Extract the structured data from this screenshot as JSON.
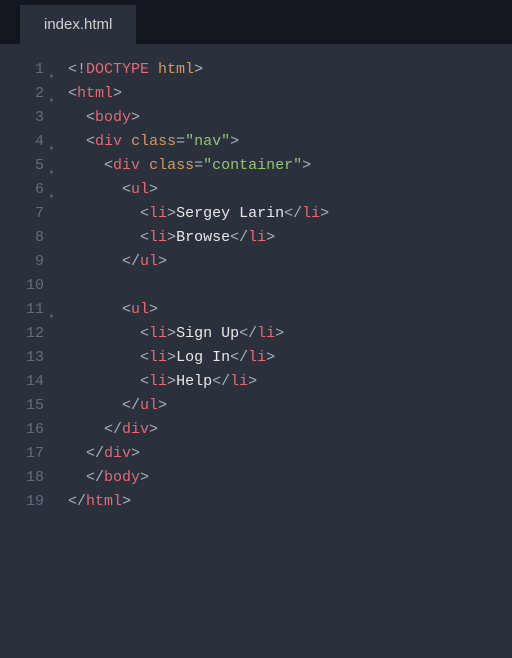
{
  "tab": {
    "filename": "index.html"
  },
  "gutter": {
    "lines": [
      "1",
      "2",
      "3",
      "4",
      "5",
      "6",
      "7",
      "8",
      "9",
      "10",
      "11",
      "12",
      "13",
      "14",
      "15",
      "16",
      "17",
      "18",
      "19"
    ],
    "foldable": [
      1,
      2,
      4,
      5,
      6,
      11
    ]
  },
  "code": {
    "lines": [
      [
        {
          "t": "<!",
          "c": "p"
        },
        {
          "t": "DOCTYPE",
          "c": "dt"
        },
        {
          "t": " html",
          "c": "an"
        },
        {
          "t": ">",
          "c": "p"
        }
      ],
      [
        {
          "t": "<",
          "c": "p"
        },
        {
          "t": "html",
          "c": "tg"
        },
        {
          "t": ">",
          "c": "p"
        }
      ],
      [
        {
          "t": "  ",
          "c": "p"
        },
        {
          "t": "<",
          "c": "p"
        },
        {
          "t": "body",
          "c": "tg"
        },
        {
          "t": ">",
          "c": "p"
        }
      ],
      [
        {
          "t": "  ",
          "c": "p"
        },
        {
          "t": "<",
          "c": "p"
        },
        {
          "t": "div",
          "c": "tg"
        },
        {
          "t": " ",
          "c": "p"
        },
        {
          "t": "class",
          "c": "an"
        },
        {
          "t": "=",
          "c": "p"
        },
        {
          "t": "\"nav\"",
          "c": "st"
        },
        {
          "t": ">",
          "c": "p"
        }
      ],
      [
        {
          "t": "    ",
          "c": "p"
        },
        {
          "t": "<",
          "c": "p"
        },
        {
          "t": "div",
          "c": "tg"
        },
        {
          "t": " ",
          "c": "p"
        },
        {
          "t": "class",
          "c": "an"
        },
        {
          "t": "=",
          "c": "p"
        },
        {
          "t": "\"container\"",
          "c": "st"
        },
        {
          "t": ">",
          "c": "p"
        }
      ],
      [
        {
          "t": "      ",
          "c": "p"
        },
        {
          "t": "<",
          "c": "p"
        },
        {
          "t": "ul",
          "c": "tg"
        },
        {
          "t": ">",
          "c": "p"
        }
      ],
      [
        {
          "t": "        ",
          "c": "p"
        },
        {
          "t": "<",
          "c": "p"
        },
        {
          "t": "li",
          "c": "tg"
        },
        {
          "t": ">",
          "c": "p"
        },
        {
          "t": "Sergey Larin",
          "c": "tx"
        },
        {
          "t": "</",
          "c": "p"
        },
        {
          "t": "li",
          "c": "tg"
        },
        {
          "t": ">",
          "c": "p"
        }
      ],
      [
        {
          "t": "        ",
          "c": "p"
        },
        {
          "t": "<",
          "c": "p"
        },
        {
          "t": "li",
          "c": "tg"
        },
        {
          "t": ">",
          "c": "p"
        },
        {
          "t": "Browse",
          "c": "tx"
        },
        {
          "t": "</",
          "c": "p"
        },
        {
          "t": "li",
          "c": "tg"
        },
        {
          "t": ">",
          "c": "p"
        }
      ],
      [
        {
          "t": "      ",
          "c": "p"
        },
        {
          "t": "</",
          "c": "p"
        },
        {
          "t": "ul",
          "c": "tg"
        },
        {
          "t": ">",
          "c": "p"
        }
      ],
      [
        {
          "t": "",
          "c": "p"
        }
      ],
      [
        {
          "t": "      ",
          "c": "p"
        },
        {
          "t": "<",
          "c": "p"
        },
        {
          "t": "ul",
          "c": "tg"
        },
        {
          "t": ">",
          "c": "p"
        }
      ],
      [
        {
          "t": "        ",
          "c": "p"
        },
        {
          "t": "<",
          "c": "p"
        },
        {
          "t": "li",
          "c": "tg"
        },
        {
          "t": ">",
          "c": "p"
        },
        {
          "t": "Sign Up",
          "c": "tx"
        },
        {
          "t": "</",
          "c": "p"
        },
        {
          "t": "li",
          "c": "tg"
        },
        {
          "t": ">",
          "c": "p"
        }
      ],
      [
        {
          "t": "        ",
          "c": "p"
        },
        {
          "t": "<",
          "c": "p"
        },
        {
          "t": "li",
          "c": "tg"
        },
        {
          "t": ">",
          "c": "p"
        },
        {
          "t": "Log In",
          "c": "tx"
        },
        {
          "t": "</",
          "c": "p"
        },
        {
          "t": "li",
          "c": "tg"
        },
        {
          "t": ">",
          "c": "p"
        }
      ],
      [
        {
          "t": "        ",
          "c": "p"
        },
        {
          "t": "<",
          "c": "p"
        },
        {
          "t": "li",
          "c": "tg"
        },
        {
          "t": ">",
          "c": "p"
        },
        {
          "t": "Help",
          "c": "tx"
        },
        {
          "t": "</",
          "c": "p"
        },
        {
          "t": "li",
          "c": "tg"
        },
        {
          "t": ">",
          "c": "p"
        }
      ],
      [
        {
          "t": "      ",
          "c": "p"
        },
        {
          "t": "</",
          "c": "p"
        },
        {
          "t": "ul",
          "c": "tg"
        },
        {
          "t": ">",
          "c": "p"
        }
      ],
      [
        {
          "t": "    ",
          "c": "p"
        },
        {
          "t": "</",
          "c": "p"
        },
        {
          "t": "div",
          "c": "tg"
        },
        {
          "t": ">",
          "c": "p"
        }
      ],
      [
        {
          "t": "  ",
          "c": "p"
        },
        {
          "t": "</",
          "c": "p"
        },
        {
          "t": "div",
          "c": "tg"
        },
        {
          "t": ">",
          "c": "p"
        }
      ],
      [
        {
          "t": "  ",
          "c": "p"
        },
        {
          "t": "</",
          "c": "p"
        },
        {
          "t": "body",
          "c": "tg"
        },
        {
          "t": ">",
          "c": "p"
        }
      ],
      [
        {
          "t": "</",
          "c": "p"
        },
        {
          "t": "html",
          "c": "tg"
        },
        {
          "t": ">",
          "c": "p"
        }
      ]
    ]
  }
}
